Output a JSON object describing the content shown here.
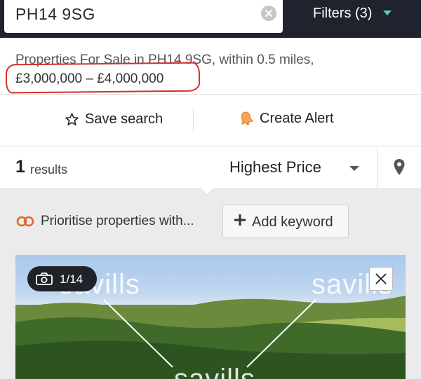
{
  "search": {
    "value": "PH14 9SG",
    "filters_label": "Filters (3)"
  },
  "summary": {
    "line1": "Properties For Sale in PH14 9SG, within 0.5 miles,",
    "price_range": "£3,000,000 – £4,000,000"
  },
  "actions": {
    "save_search": "Save search",
    "create_alert": "Create Alert"
  },
  "results": {
    "count": "1",
    "count_label": "results",
    "sort": "Highest Price"
  },
  "keywords": {
    "prioritise": "Prioritise properties with...",
    "add_keyword": "Add keyword"
  },
  "listing": {
    "photo_counter": "1/14",
    "watermark": "savills"
  },
  "colors": {
    "topbar": "#20232d",
    "accent_teal": "#4fd2c2",
    "alert_orange": "#e58a2e",
    "annotation_red": "#d0312d"
  },
  "icons": [
    "clear-icon",
    "filters-caret-icon",
    "star-icon",
    "bell-icon",
    "sort-caret-icon",
    "map-pin-icon",
    "infinity-icon",
    "plus-icon",
    "camera-icon",
    "close-icon"
  ]
}
